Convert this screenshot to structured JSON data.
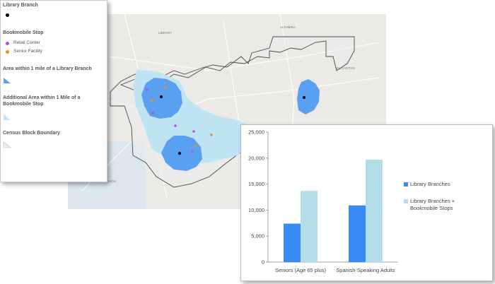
{
  "legend": {
    "library_branch": {
      "title": "Library Branch",
      "color": "#000000"
    },
    "bookmobile_stop": {
      "title": "Bookmobile Stop",
      "retail": {
        "label": "Retail Center",
        "color": "#b94fd8"
      },
      "senior": {
        "label": "Senior Facility",
        "color": "#e8901c"
      }
    },
    "within_mile": {
      "title": "Area within 1 mile of a Library Branch",
      "color": "#5aa0f0"
    },
    "additional_area": {
      "title": "Additional Area within 1 Mile of a Bookmobile Stop",
      "color": "#bfe4f3"
    },
    "census": {
      "title": "Census Block Boundary",
      "color": "#eeeeee"
    }
  },
  "map": {
    "labels": [
      "LIBRARY",
      "ALTAMIRA",
      "EL CAPITAN",
      "IMPERIAL BEACH"
    ]
  },
  "chart_data": {
    "type": "bar",
    "categories": [
      "Seniors (Age 65 plus)",
      "Spanish-Speaking Adults"
    ],
    "series": [
      {
        "name": "Library Branches",
        "color": "#3a8af5",
        "values": [
          7400,
          10900
        ]
      },
      {
        "name": "Library Branches + Bookmobile Stops",
        "color": "#b3dde7",
        "values": [
          13700,
          19700
        ]
      }
    ],
    "y_ticks": [
      "0",
      "5,000",
      "10,000",
      "15,000",
      "20,000",
      "25,000"
    ],
    "ylim": [
      0,
      25000
    ],
    "grid": false,
    "legend_position": "right"
  }
}
